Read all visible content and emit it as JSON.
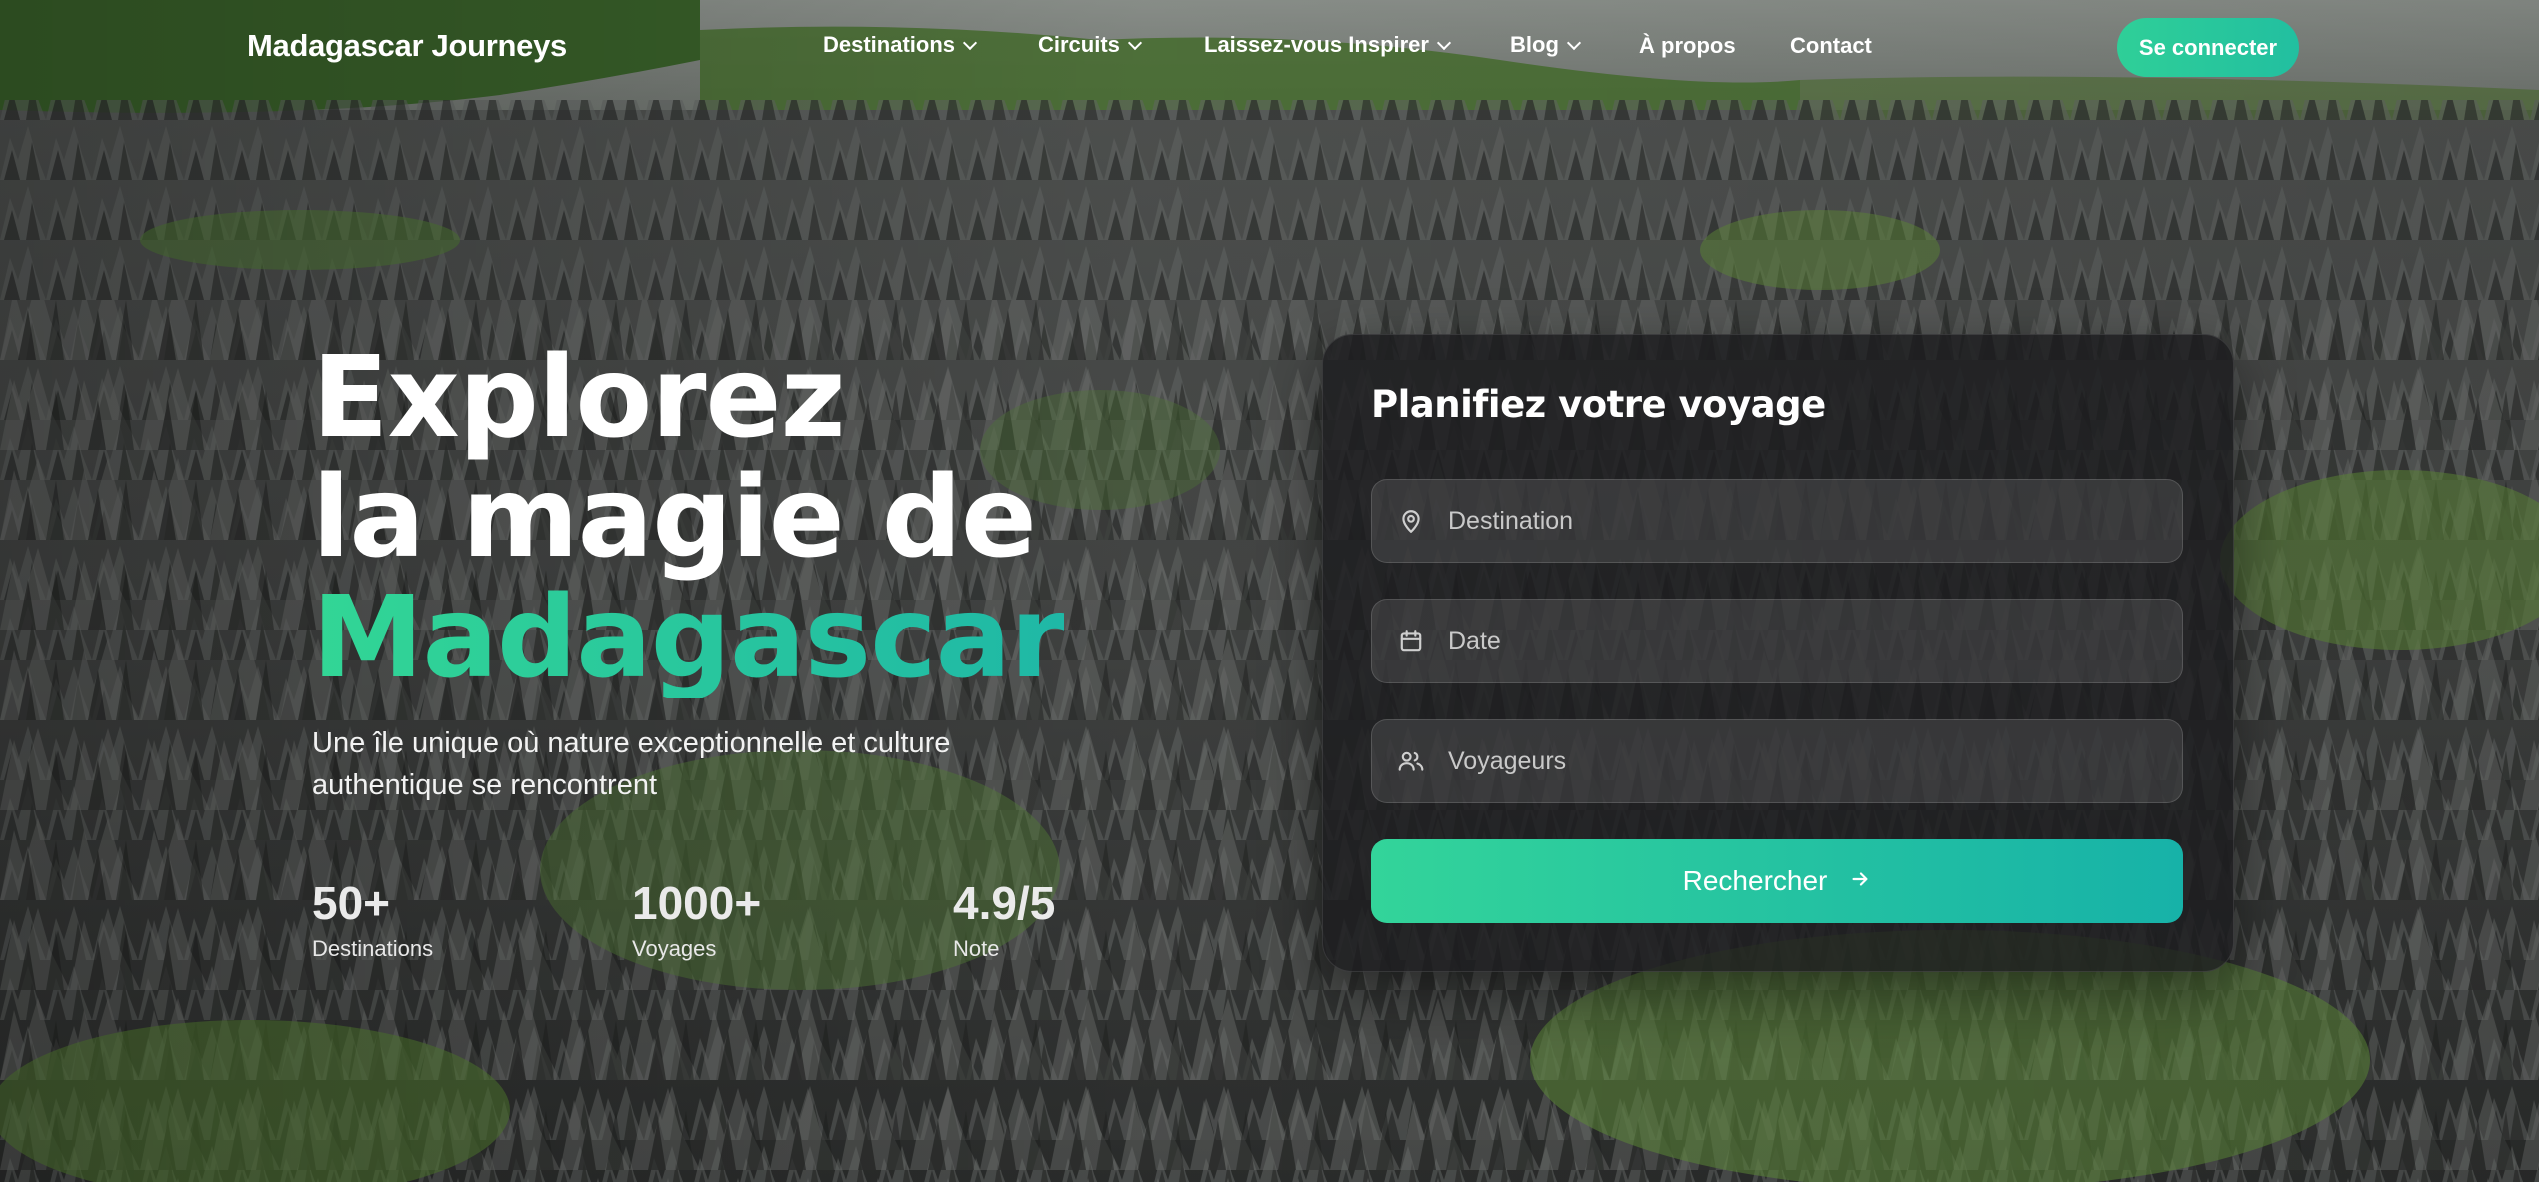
{
  "brand": "Madagascar Journeys",
  "nav": {
    "items": [
      {
        "label": "Destinations",
        "dropdown": true
      },
      {
        "label": "Circuits",
        "dropdown": true
      },
      {
        "label": "Laissez-vous Inspirer",
        "dropdown": true
      },
      {
        "label": "Blog",
        "dropdown": true
      },
      {
        "label": "À propos",
        "dropdown": false
      },
      {
        "label": "Contact",
        "dropdown": false
      }
    ],
    "login_label": "Se connecter"
  },
  "hero": {
    "line1": "Explorez",
    "line2": "la magie de",
    "line3": "Madagascar",
    "subtitle": "Une île unique où nature exceptionnelle et culture authentique se rencontrent"
  },
  "stats": [
    {
      "value": "50+",
      "label": "Destinations"
    },
    {
      "value": "1000+",
      "label": "Voyages"
    },
    {
      "value": "4.9/5",
      "label": "Note"
    }
  ],
  "planner": {
    "title": "Planifiez votre voyage",
    "fields": [
      {
        "placeholder": "Destination",
        "icon": "map-pin-icon"
      },
      {
        "placeholder": "Date",
        "icon": "calendar-icon"
      },
      {
        "placeholder": "Voyageurs",
        "icon": "users-icon"
      }
    ],
    "search_label": "Rechercher"
  },
  "colors": {
    "accent": "#2fcf98",
    "accent_end": "#1ab3a8",
    "card_bg": "#1c1c1e"
  }
}
